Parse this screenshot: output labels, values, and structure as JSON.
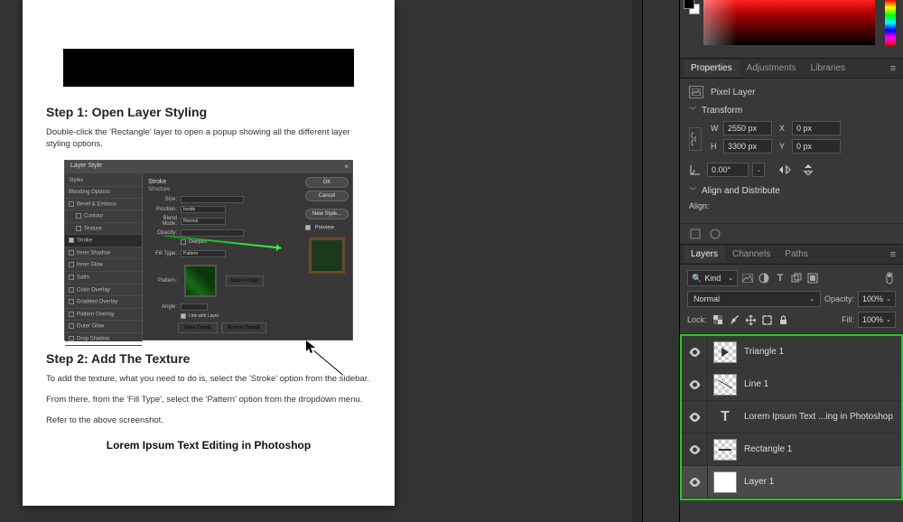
{
  "document": {
    "step1_title": "Step 1: Open Layer Styling",
    "step1_body": "Double-click the 'Rectangle' layer to open a popup showing all the different layer styling options.",
    "step2_title": "Step 2: Add The Texture",
    "step2_body1": "To add the texture, what you need to do is, select the 'Stroke' option from the sidebar.",
    "step2_body2": "From there, from the 'Fill Type', select the 'Pattern' option from the dropdown menu.",
    "step2_body3": "Refer to the above screenshot.",
    "center_text": "Lorem Ipsum Text Editing in Photoshop",
    "layer_style": {
      "title": "Layer Style",
      "sidebar": [
        "Styles",
        "Blending Options",
        "Bevel & Emboss",
        "Contour",
        "Texture",
        "Stroke",
        "Inner Shadow",
        "Inner Glow",
        "Satin",
        "Color Overlay",
        "Gradient Overlay",
        "Pattern Overlay",
        "Outer Glow",
        "Drop Shadow"
      ],
      "section_title": "Stroke",
      "section_sub": "Structure",
      "rows": {
        "size": "Size:",
        "position": "Position:",
        "blend": "Blend Mode:",
        "opacity": "Opacity:",
        "fill_type": "Fill Type:",
        "pattern": "Pattern:",
        "angle": "Angle:"
      },
      "position_val": "Inside",
      "blend_val": "Normal",
      "fill_type_val": "Pattern",
      "snap_origin": "Snap to Origin",
      "link_layer": "Link with Layer",
      "make_default": "Make Default",
      "reset_default": "Reset to Default",
      "buttons": {
        "ok": "OK",
        "cancel": "Cancel",
        "new_style": "New Style...",
        "preview": "Preview"
      }
    }
  },
  "panels": {
    "properties_tabs": {
      "properties": "Properties",
      "adjustments": "Adjustments",
      "libraries": "Libraries"
    },
    "pixel_layer": "Pixel Layer",
    "transform": {
      "title": "Transform",
      "w_label": "W",
      "w_val": "2550 px",
      "h_label": "H",
      "h_val": "3300 px",
      "x_label": "X",
      "x_val": "0 px",
      "y_label": "Y",
      "y_val": "0 px",
      "angle": "0.00°"
    },
    "align": {
      "title": "Align and Distribute",
      "label": "Align:"
    },
    "layers_tabs": {
      "layers": "Layers",
      "channels": "Channels",
      "paths": "Paths"
    },
    "layers_ctl": {
      "kind": "Kind",
      "blend_mode": "Normal",
      "opacity_label": "Opacity:",
      "opacity_val": "100%",
      "lock_label": "Lock:",
      "fill_label": "Fill:",
      "fill_val": "100%"
    },
    "layers": [
      {
        "name": "Triangle 1",
        "type": "shape"
      },
      {
        "name": "Line 1",
        "type": "shape"
      },
      {
        "name": "Lorem Ipsum Text ...ing in Photoshop",
        "type": "text"
      },
      {
        "name": "Rectangle 1",
        "type": "shape"
      },
      {
        "name": "Layer 1",
        "type": "pixel",
        "selected": true
      }
    ]
  }
}
